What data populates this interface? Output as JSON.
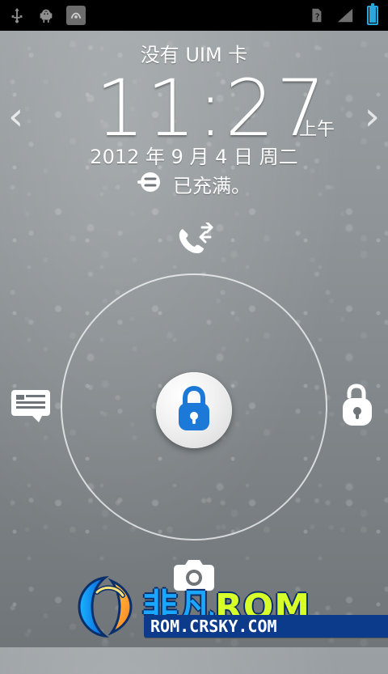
{
  "status_bar": {
    "left_icons": [
      "usb-icon",
      "android-debug-icon",
      "app-notification-icon"
    ],
    "right_icons": [
      "no-sim-icon",
      "signal-icon",
      "battery-icon"
    ],
    "battery_level": 1.0
  },
  "lockscreen": {
    "carrier_text": "没有 UIM 卡",
    "time": "11:27",
    "ampm": "上午",
    "date": "2012 年 9 月 4 日 周二",
    "charge_status": "已充满。",
    "nav_left": "‹",
    "nav_right": "›"
  },
  "watermark": {
    "brand_cn": "非凡",
    "brand_en": "ROM",
    "url": "ROM.CRSKY.COM"
  },
  "colors": {
    "accent": "#2aa7d9",
    "lock_blue": "#1c79d8",
    "watermark_green": "#d7ff2a",
    "watermark_blue": "#0b3b8a"
  }
}
